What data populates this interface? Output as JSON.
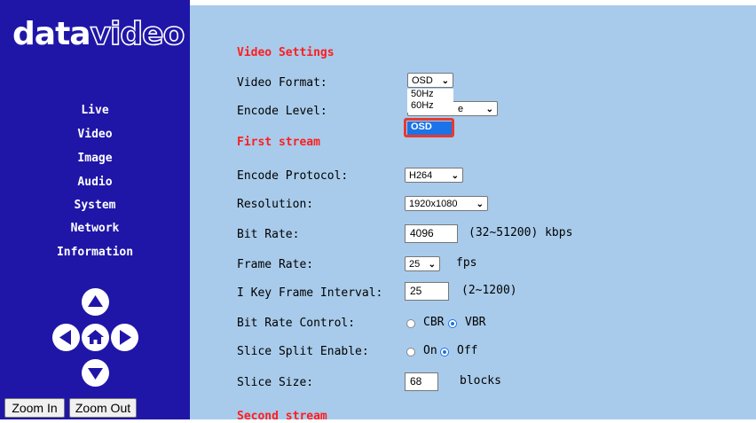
{
  "brand": {
    "logo_part1": "data",
    "logo_part2": "video"
  },
  "sidebar": {
    "items": [
      {
        "label": "Live"
      },
      {
        "label": "Video"
      },
      {
        "label": "Image"
      },
      {
        "label": "Audio"
      },
      {
        "label": "System"
      },
      {
        "label": "Network"
      },
      {
        "label": "Information"
      }
    ],
    "zoom_in": "Zoom In",
    "zoom_out": "Zoom Out"
  },
  "video_settings": {
    "title": "Video Settings",
    "video_format": {
      "label": "Video Format:",
      "value": "OSD",
      "options": [
        "50Hz",
        "60Hz",
        "OSD"
      ],
      "selected_option": "OSD"
    },
    "encode_level": {
      "label": "Encode Level:",
      "value_visible": "e"
    }
  },
  "first_stream": {
    "title": "First stream",
    "encode_protocol": {
      "label": "Encode Protocol:",
      "value": "H264"
    },
    "resolution": {
      "label": "Resolution:",
      "value": "1920x1080"
    },
    "bit_rate": {
      "label": "Bit Rate:",
      "value": "4096",
      "hint": "(32~51200) kbps"
    },
    "frame_rate": {
      "label": "Frame Rate:",
      "value": "25",
      "unit": "fps"
    },
    "key_frame_interval": {
      "label": "I Key Frame Interval:",
      "value": "25",
      "hint": "(2~1200)"
    },
    "bit_rate_control": {
      "label": "Bit Rate Control:",
      "options": [
        "CBR",
        "VBR"
      ],
      "selected": "VBR"
    },
    "slice_split": {
      "label": "Slice Split Enable:",
      "options": [
        "On",
        "Off"
      ],
      "selected": "Off"
    },
    "slice_size": {
      "label": "Slice Size:",
      "value": "68",
      "unit": "blocks"
    }
  },
  "second_stream": {
    "title": "Second stream"
  },
  "colors": {
    "sidebar_bg": "#1f16a8",
    "main_bg": "#a8cbeb",
    "section_title": "#ff1d1d",
    "highlight": "#e8392f",
    "accent": "#1a73e8"
  }
}
